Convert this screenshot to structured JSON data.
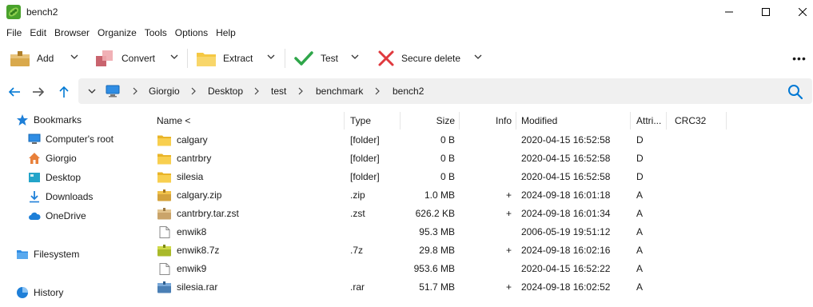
{
  "window": {
    "title": "bench2"
  },
  "menu": [
    "File",
    "Edit",
    "Browser",
    "Organize",
    "Tools",
    "Options",
    "Help"
  ],
  "toolbar": {
    "add_label": "Add",
    "convert_label": "Convert",
    "extract_label": "Extract",
    "test_label": "Test",
    "secure_delete_label": "Secure delete",
    "more_label": "•••"
  },
  "breadcrumb": [
    "Giorgio",
    "Desktop",
    "test",
    "benchmark",
    "bench2"
  ],
  "sidebar": {
    "items": [
      {
        "label": "Bookmarks",
        "icon": "star-icon"
      },
      {
        "label": "Computer's root",
        "icon": "monitor-icon"
      },
      {
        "label": "Giorgio",
        "icon": "home-icon"
      },
      {
        "label": "Desktop",
        "icon": "desktop-icon"
      },
      {
        "label": "Downloads",
        "icon": "download-icon"
      },
      {
        "label": "OneDrive",
        "icon": "cloud-icon"
      },
      {
        "label": "Filesystem",
        "icon": "folder-icon"
      },
      {
        "label": "History",
        "icon": "history-icon"
      }
    ]
  },
  "table": {
    "columns": [
      "Name <",
      "Type",
      "Size",
      "Info",
      "Modified",
      "Attri...",
      "CRC32"
    ],
    "rows": [
      {
        "name": "calgary",
        "type": "[folder]",
        "size": "0 B",
        "info": "",
        "modified": "2020-04-15 16:52:58",
        "attr": "D",
        "crc": "",
        "icon": "folder"
      },
      {
        "name": "cantrbry",
        "type": "[folder]",
        "size": "0 B",
        "info": "",
        "modified": "2020-04-15 16:52:58",
        "attr": "D",
        "crc": "",
        "icon": "folder"
      },
      {
        "name": "silesia",
        "type": "[folder]",
        "size": "0 B",
        "info": "",
        "modified": "2020-04-15 16:52:58",
        "attr": "D",
        "crc": "",
        "icon": "folder"
      },
      {
        "name": "calgary.zip",
        "type": ".zip",
        "size": "1.0 MB",
        "info": "+",
        "modified": "2024-09-18 16:01:18",
        "attr": "A",
        "crc": "",
        "icon": "zip"
      },
      {
        "name": "cantrbry.tar.zst",
        "type": ".zst",
        "size": "626.2 KB",
        "info": "+",
        "modified": "2024-09-18 16:01:34",
        "attr": "A",
        "crc": "",
        "icon": "zst"
      },
      {
        "name": "enwik8",
        "type": "",
        "size": "95.3 MB",
        "info": "",
        "modified": "2006-05-19 19:51:12",
        "attr": "A",
        "crc": "",
        "icon": "file"
      },
      {
        "name": "enwik8.7z",
        "type": ".7z",
        "size": "29.8 MB",
        "info": "+",
        "modified": "2024-09-18 16:02:16",
        "attr": "A",
        "crc": "",
        "icon": "7z"
      },
      {
        "name": "enwik9",
        "type": "",
        "size": "953.6 MB",
        "info": "",
        "modified": "2020-04-15 16:52:22",
        "attr": "A",
        "crc": "",
        "icon": "file"
      },
      {
        "name": "silesia.rar",
        "type": ".rar",
        "size": "51.7 MB",
        "info": "+",
        "modified": "2024-09-18 16:02:52",
        "attr": "A",
        "crc": "",
        "icon": "rar"
      }
    ]
  },
  "colors": {
    "accent": "#0078d4",
    "folder": "#f5c843",
    "check": "#2fa64a",
    "cross": "#e0393e"
  }
}
